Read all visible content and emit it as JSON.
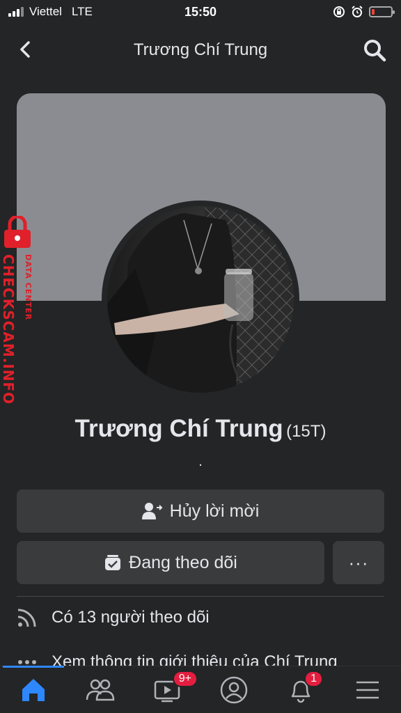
{
  "status_bar": {
    "carrier": "Viettel",
    "network": "LTE",
    "time": "15:50"
  },
  "header": {
    "title": "Trương Chí Trung"
  },
  "profile": {
    "name": "Trương Chí Trung",
    "alt_name": "(15T)",
    "bio": "."
  },
  "watermark": {
    "line1": "DATA CENTER",
    "line2": "CHECKSCAM.INFO"
  },
  "actions": {
    "cancel_request_label": "Hủy lời mời",
    "following_label": "Đang theo dõi",
    "more_label": "···"
  },
  "info": {
    "followers_text": "Có 13 người theo dõi",
    "about_text": "Xem thông tin giới thiệu của Chí Trung"
  },
  "nav": {
    "watch_badge": "9+",
    "notifications_badge": "1"
  },
  "colors": {
    "accent": "#2d88ff",
    "badge": "#e41e3f",
    "watermark": "#e0202a"
  }
}
